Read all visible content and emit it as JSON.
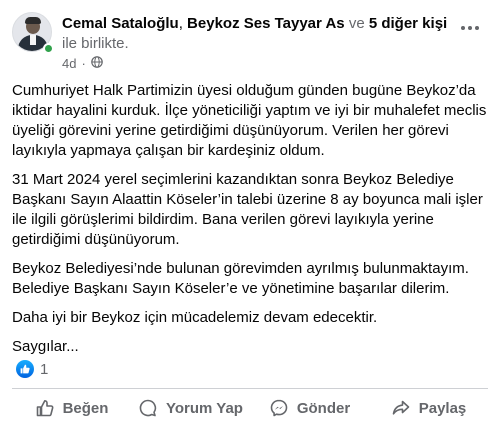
{
  "post": {
    "author": "Cemal Sataloğlu",
    "tagged_primary": "Beykoz Ses Tayyar As",
    "connector": "ve",
    "others": "5 diğer kişi",
    "with_text": "ile birlikte.",
    "time": "4d",
    "privacy_icon": "globe-icon",
    "paragraphs": [
      "Cumhuriyet Halk Partimizin üyesi olduğum günden bugüne Beykoz’da iktidar hayalini kurduk. İlçe yöneticiliği yaptım ve iyi bir muhalefet meclis üyeliği görevini yerine getirdiğimi düşünüyorum. Verilen her görevi layıkıyla yapmaya çalışan bir kardeşiniz oldum.",
      "31 Mart 2024 yerel seçimlerini kazandıktan sonra Beykoz Belediye Başkanı Sayın Alaattin Köseler’in talebi üzerine 8 ay boyunca  mali işler ile ilgili görüşlerimi bildirdim. Bana verilen görevi layıkıyla yerine getirdiğimi düşünüyorum.",
      "Beykoz Belediyesi’nde bulunan görevimden ayrılmış bulunmaktayım. Belediye Başkanı Sayın Köseler’e ve yönetimine başarılar dilerim.",
      "Daha iyi bir Beykoz için mücadelemiz devam edecektir.",
      "Saygılar..."
    ]
  },
  "reactions": {
    "count": "1",
    "icon": "like-icon"
  },
  "actions": {
    "like": "Beğen",
    "comment": "Yorum Yap",
    "send": "Gönder",
    "share": "Paylaş"
  },
  "colors": {
    "accent": "#0866ff",
    "muted": "#65676b",
    "online": "#31a24c"
  }
}
